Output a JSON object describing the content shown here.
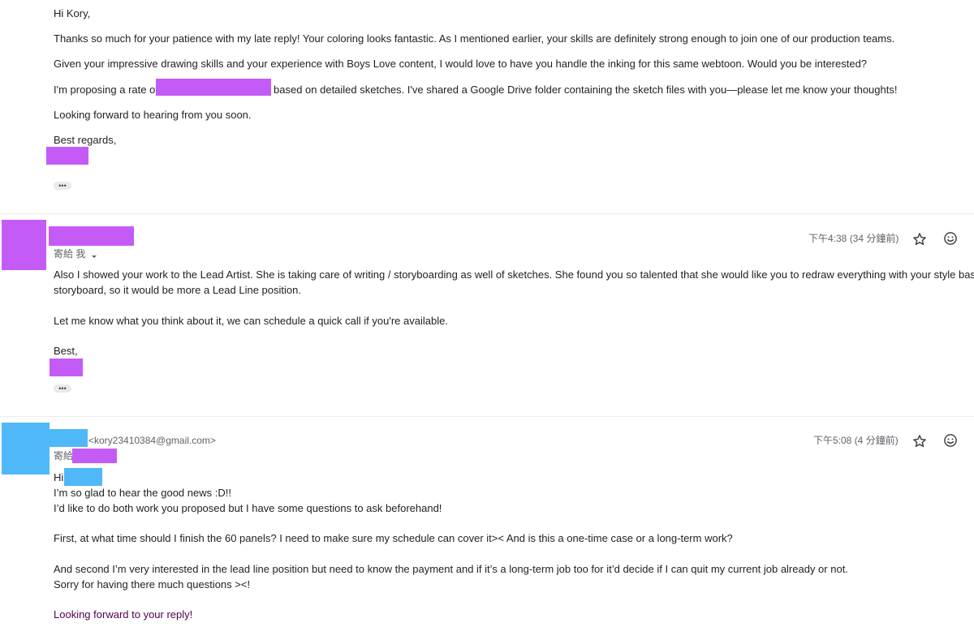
{
  "message1": {
    "greeting": "Hi Kory,",
    "para1": "Thanks so much for your patience with my late reply! Your coloring looks fantastic. As I mentioned earlier, your skills are definitely strong enough to join one of our production teams.",
    "para2": "Given your impressive drawing skills and your experience with Boys Love content, I would love to have you handle the inking for this same webtoon. Would you be interested?",
    "para3_prefix": "I'm proposing a rate of",
    "para3_suffix": "based on detailed sketches. I've shared a Google Drive folder containing the sketch files with you—please let me know your thoughts!",
    "para4": "Looking forward to hearing from you soon.",
    "signoff": "Best regards,",
    "more": "•••"
  },
  "message2": {
    "to_label": "寄給 我",
    "timestamp": "下午4:38 (34 分鐘前)",
    "body_line1": "Also I showed your work to the Lead Artist. She is taking care of writing / storyboarding as well of sketches. She found you so talented that she would like you to redraw everything with your style based on",
    "body_line2": "storyboard, so it would be more a Lead Line position.",
    "body_line3": "Let me know what you think about it, we can schedule a quick call if you're available.",
    "signoff": "Best,",
    "more": "•••"
  },
  "message3": {
    "sender_email": "<kory23410384@gmail.com>",
    "to_label": "寄給",
    "timestamp": "下午5:08 (4 分鐘前)",
    "greeting": "Hi,",
    "line1": "I’m so glad to hear the good news :D!!",
    "line2": "I’d like to do both work you proposed but I have some questions to ask beforehand!",
    "line3": "First, at what time should I finish the 60 panels? I need to make sure my schedule can cover it>< And is this a one-time case or a long-term work?",
    "line4": "And second I’m very interested in the lead line position but need to know the payment and if it’s a long-term job too for it’d decide if I can quit my current job already or not.",
    "line5": "Sorry for having there much questions ><!",
    "closing": "Looking forward to your reply!"
  },
  "icons": {
    "star": "star-icon",
    "emoji": "emoji-react-icon",
    "dropdown": "chevron-down-icon"
  },
  "colors": {
    "redact_purple": "#c55bf7",
    "redact_blue": "#4fb8f8"
  }
}
